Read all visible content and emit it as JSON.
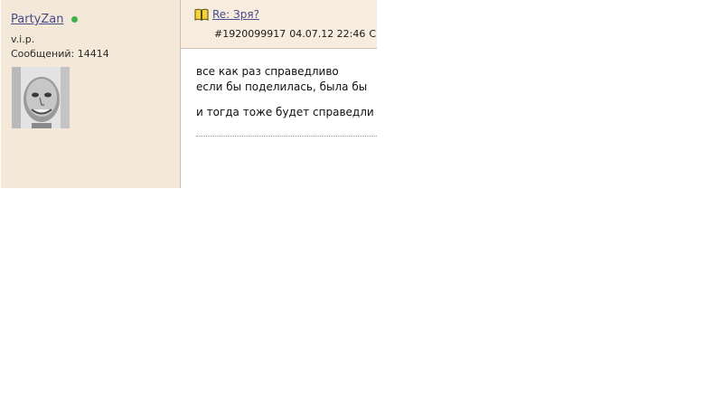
{
  "author": {
    "username": "PartyZan",
    "online_color": "#3fb24a",
    "rank": "v.i.p.",
    "message_count": "Сообщений: 14414"
  },
  "post": {
    "title_icon": "book-icon",
    "title": "Re: Зря?",
    "number": "#1920099917",
    "datetime": "04.07.12 22:46",
    "meta_trailing": "С",
    "lines": [
      "все как раз справедливо",
      "если бы поделилась, была бы",
      "и тогда тоже будет справедли"
    ]
  },
  "colors": {
    "sidebar_bg": "#f4e8d8",
    "header_bg": "#f7ecdd",
    "link": "#464c8a"
  }
}
